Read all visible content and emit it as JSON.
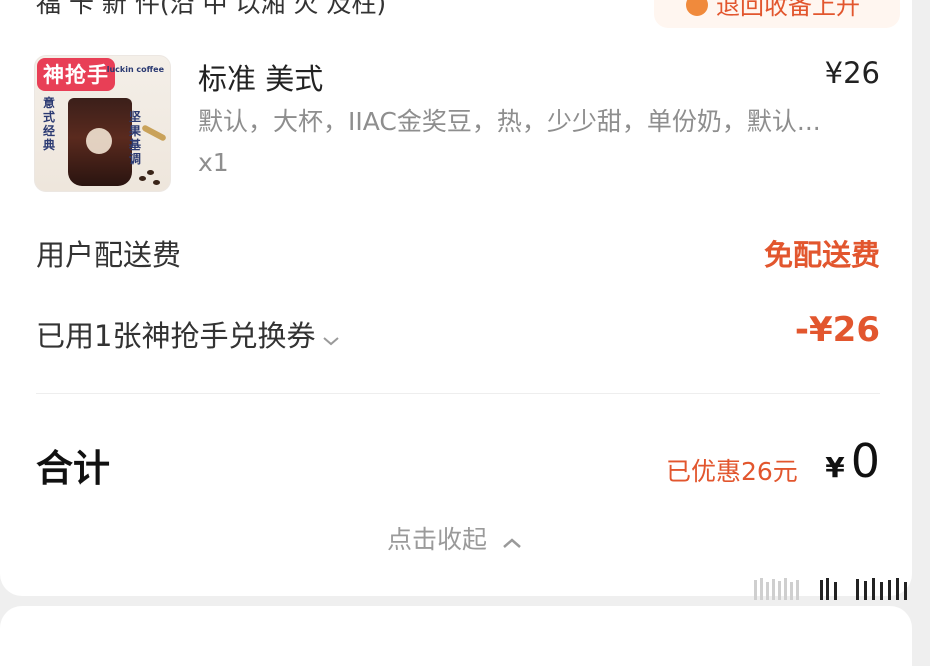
{
  "top_row": {
    "left_text": "福 卡 新 件(沿 中 以湘 火 及柱)",
    "right_text": "退回收备上升"
  },
  "product": {
    "badge": "神抢手",
    "brand": "luckin coffee",
    "thumb_left_text": "意式经典",
    "thumb_right_text": "坚果基调",
    "name": "标准 美式",
    "price": "¥26",
    "options": "默认，大杯，IIAC金奖豆，热，少少甜，单份奶，默认...",
    "qty": "x1"
  },
  "delivery": {
    "label": "用户配送费",
    "value": "免配送费"
  },
  "coupon": {
    "label": "已用1张神抢手兑换券",
    "value": "-¥26"
  },
  "total": {
    "label": "合计",
    "saved": "已优惠26元",
    "currency": "¥",
    "amount": "0"
  },
  "collapse": {
    "label": "点击收起"
  },
  "colors": {
    "accent": "#e2562e",
    "badge": "#e83f56",
    "muted_text": "#8e8e8e"
  },
  "icons": {
    "coupon_chevron": "chevron-down-icon",
    "collapse_chevron": "chevron-up-icon"
  }
}
